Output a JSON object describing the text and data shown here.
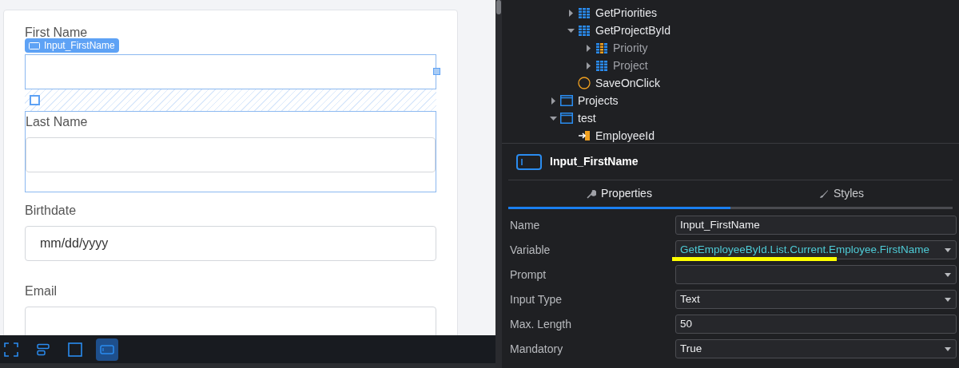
{
  "canvas": {
    "badge": "Input_FirstName",
    "fields": [
      {
        "label": "First Name",
        "selected": true
      },
      {
        "label": "Last Name",
        "selected": false
      },
      {
        "label": "Birthdate",
        "placeholder": "mm/dd/yyyy",
        "selected": false
      },
      {
        "label": "Email",
        "selected": false
      }
    ]
  },
  "toolbar": {
    "tools": [
      {
        "kind": "frame",
        "selected": false
      },
      {
        "kind": "container",
        "selected": false
      },
      {
        "kind": "square",
        "selected": false
      },
      {
        "kind": "input",
        "selected": true
      }
    ]
  },
  "tree": {
    "partial_items": [
      {
        "label": "GetPriorities",
        "kind": "table",
        "expanded": false,
        "muted": false
      },
      {
        "label": "GetProjectById",
        "kind": "table",
        "expanded": true,
        "muted": false,
        "children": [
          {
            "label": "Priority",
            "kind": "table-mixed",
            "expanded": false,
            "muted": true
          },
          {
            "label": "Project",
            "kind": "table",
            "expanded": false,
            "muted": true
          }
        ]
      },
      {
        "label": "SaveOnClick",
        "kind": "action",
        "muted": false
      }
    ],
    "items": [
      {
        "label": "Projects",
        "kind": "screen",
        "expanded": false,
        "muted": false
      },
      {
        "label": "test",
        "kind": "screen",
        "expanded": true,
        "muted": false,
        "children": [
          {
            "label": "EmployeeId",
            "kind": "input-param",
            "muted": false
          }
        ]
      }
    ]
  },
  "properties": {
    "title": "Input_FirstName",
    "tabs": [
      {
        "label": "Properties",
        "kind": "wrench",
        "selected": true
      },
      {
        "label": "Styles",
        "kind": "brush",
        "selected": false
      }
    ],
    "rows": [
      {
        "label": "Name",
        "kind": "text",
        "value": "Input_FirstName",
        "highlighted": false,
        "variable": false
      },
      {
        "label": "Variable",
        "kind": "select",
        "value": "GetEmployeeById.List.Current.Employee.FirstName",
        "highlighted": true,
        "variable": true
      },
      {
        "label": "Prompt",
        "kind": "select",
        "highlighted": false
      },
      {
        "label": "Input Type",
        "kind": "select",
        "value": "Text",
        "highlighted": false,
        "variable": false
      },
      {
        "label": "Max. Length",
        "kind": "text",
        "value": "50",
        "highlighted": false,
        "variable": false
      },
      {
        "label": "Mandatory",
        "kind": "select",
        "value": "True",
        "highlighted": false,
        "variable": false
      }
    ]
  }
}
